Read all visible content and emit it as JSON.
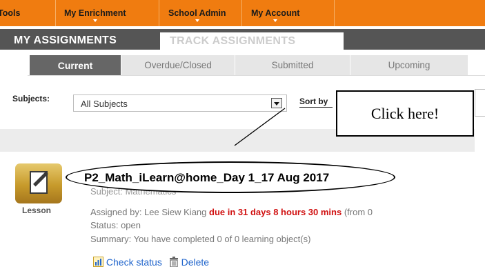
{
  "nav": {
    "items": [
      "Tools",
      "My Enrichment",
      "School Admin",
      "My Account"
    ]
  },
  "tabs": {
    "my_assignments": "MY ASSIGNMENTS",
    "track_assignments": "TRACK ASSIGNMENTS"
  },
  "subtabs": [
    "Current",
    "Overdue/Closed",
    "Submitted",
    "Upcoming"
  ],
  "filter": {
    "subjects_label": "Subjects:",
    "subjects_value": "All Subjects",
    "sort_label": "Sort by"
  },
  "callout": {
    "text": "Click here!"
  },
  "assignment": {
    "type_label": "Lesson",
    "title": "P2_Math_iLearn@home_Day 1_17 Aug 2017",
    "subject": "Subject: Mathematics",
    "assigned_prefix": "Assigned by: Lee Siew Kiang",
    "due": "due in 31 days 8 hours 30 mins",
    "from_suffix": "(from 0",
    "status": "Status: open",
    "summary": "Summary: You have completed 0 of 0 learning object(s)"
  },
  "actions": {
    "check_status": "Check status",
    "delete": "Delete"
  },
  "icons": {
    "lesson": "lesson-icon",
    "check_status": "chart-icon",
    "delete": "trash-icon"
  },
  "colors": {
    "nav_orange": "#f07c10",
    "header_gray": "#555555",
    "due_red": "#d01010",
    "link_blue": "#2266cc"
  }
}
